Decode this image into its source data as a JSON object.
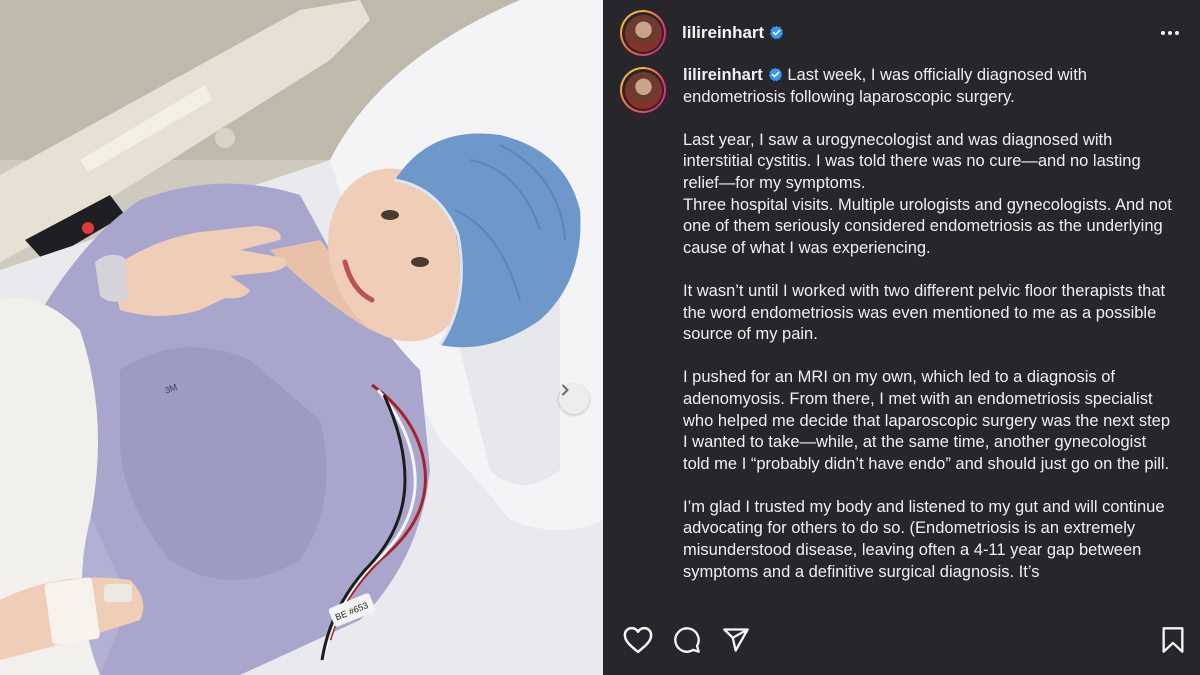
{
  "post": {
    "username": "lilireinhart",
    "verified": true,
    "caption_paragraphs": [
      "Last week, I was officially diagnosed with endometriosis following laparoscopic surgery.",
      "Last year, I saw a urogynecologist and was diagnosed with interstitial cystitis. I was told there was no cure—and no lasting relief—for my symptoms.\nThree hospital visits. Multiple urologists and gynecologists. And not one of them seriously considered endometriosis as the underlying cause of what I was experiencing.",
      "It wasn’t until I worked with two different pelvic floor therapists that the word endometriosis was even mentioned to me as a possible source of my pain.",
      "I pushed for an MRI on my own, which led to a diagnosis of adenomyosis. From there, I met with an endometriosis specialist who helped me decide that laparoscopic surgery was the next step I wanted to take—while, at the same time, another gynecologist told me I “probably didn’t have endo” and should just go on the pill.",
      "I’m glad I trusted my body and listened to my gut and will continue advocating for others to do so. (Endometriosis is an extremely misunderstood disease, leaving often a 4-11 year gap between symptoms and a definitive surgical diagnosis. It’s"
    ],
    "photo_texts": {
      "gown_brand": "3M",
      "wire_tag": "BE #653"
    }
  },
  "icons": {
    "verified": "verified-badge-icon",
    "more": "more-options-icon",
    "like": "heart-icon",
    "comment": "comment-icon",
    "share": "send-icon",
    "save": "bookmark-icon",
    "next": "chevron-right-icon"
  },
  "colors": {
    "panel_bg": "#26262b",
    "verified_blue": "#3897f0",
    "text": "#f5f5f5"
  }
}
